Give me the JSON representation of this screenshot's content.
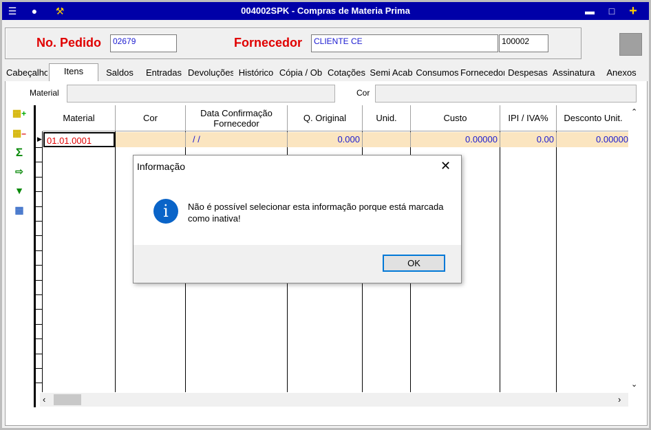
{
  "window": {
    "title": "004002SPK - Compras de Materia Prima"
  },
  "header": {
    "order_label": "No. Pedido",
    "order_value": "02679",
    "supplier_label": "Fornecedor",
    "supplier_value": "CLIENTE CE",
    "supplier_code": "100002"
  },
  "tabs": [
    {
      "label": "Cabeçalho"
    },
    {
      "label": "Itens"
    },
    {
      "label": "Saldos"
    },
    {
      "label": "Entradas"
    },
    {
      "label": "Devoluções"
    },
    {
      "label": "Histórico"
    },
    {
      "label": "Cópia / Ob"
    },
    {
      "label": "Cotações"
    },
    {
      "label": "Semi Acab"
    },
    {
      "label": "Consumos"
    },
    {
      "label": "Fornecedor"
    },
    {
      "label": "Despesas"
    },
    {
      "label": "Assinaturas"
    },
    {
      "label": "Anexos"
    }
  ],
  "filters": {
    "material_label": "Material",
    "color_label": "Cor"
  },
  "grid": {
    "columns": [
      "Material",
      "Cor",
      "Data Confirmação Fornecedor",
      "Q. Original",
      "Unid.",
      "Custo",
      "IPI / IVA%",
      "Desconto Unit."
    ],
    "row": {
      "material": "01.01.0001",
      "color": "",
      "date": "/ /",
      "qty": "0.000",
      "unit": "",
      "cost": "0.00000",
      "ipi": "0.00",
      "discount": "0.00000"
    }
  },
  "dialog": {
    "title": "Informação",
    "message": "Não é possível selecionar esta informação porque está marcada como inativa!",
    "ok_label": "OK",
    "icon": "info-icon",
    "icon_glyph": "i"
  },
  "colors": {
    "titlebar": "#0000a8",
    "accent_red": "#e00000",
    "value_blue": "#1a1ad0",
    "row_highlight": "#fbe5c0",
    "info_blue": "#0a64c8"
  }
}
